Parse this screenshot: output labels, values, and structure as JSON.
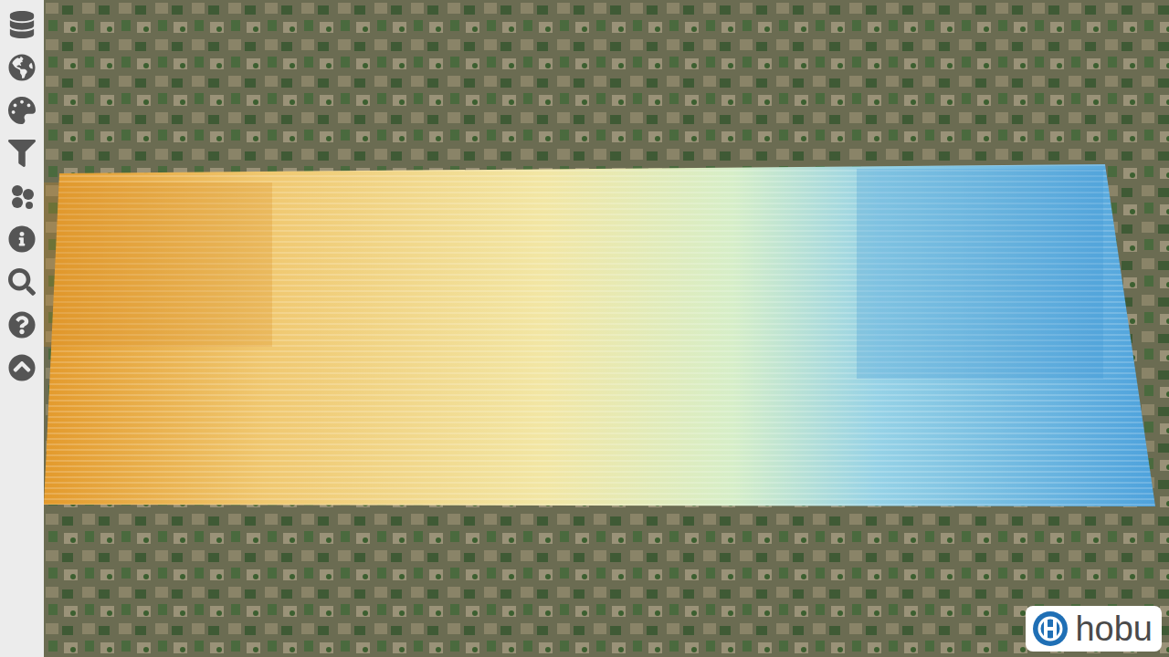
{
  "logo": {
    "text": "hobu"
  }
}
